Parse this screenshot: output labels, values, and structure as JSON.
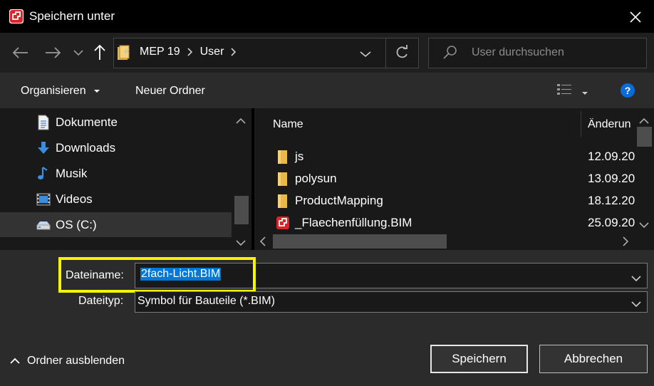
{
  "window": {
    "title": "Speichern unter"
  },
  "nav": {
    "crumb_sep": "«",
    "crumbs": [
      "MEP 19",
      "User"
    ],
    "search_placeholder": "User durchsuchen"
  },
  "toolbar": {
    "organize": "Organisieren",
    "new_folder": "Neuer Ordner"
  },
  "tree": [
    {
      "label": "Dokumente",
      "icon": "document-icon"
    },
    {
      "label": "Downloads",
      "icon": "download-icon"
    },
    {
      "label": "Musik",
      "icon": "music-icon"
    },
    {
      "label": "Videos",
      "icon": "video-icon"
    },
    {
      "label": "OS (C:)",
      "icon": "drive-icon"
    }
  ],
  "files": {
    "col_name": "Name",
    "col_date": "Änderun",
    "rows": [
      {
        "name": "js",
        "date": "12.09.20",
        "icon": "folder-icon"
      },
      {
        "name": "polysun",
        "date": "13.09.20",
        "icon": "folder-icon"
      },
      {
        "name": "ProductMapping",
        "date": "18.12.20",
        "icon": "folder-icon"
      },
      {
        "name": "_Flaechenfüllung.BIM",
        "date": "25.09.20",
        "icon": "bim-file-icon"
      }
    ]
  },
  "form": {
    "filename_label": "Dateiname:",
    "filename_value": "2fach-Licht.BIM",
    "filetype_label": "Dateityp:",
    "filetype_value": "Symbol für Bauteile (*.BIM)"
  },
  "footer": {
    "hide_folders": "Ordner ausblenden",
    "save": "Speichern",
    "cancel": "Abbrechen"
  },
  "colors": {
    "accent": "#0078d7",
    "highlight": "#f5f500",
    "folder": "#e8b84a",
    "app_red": "#d9252a"
  }
}
